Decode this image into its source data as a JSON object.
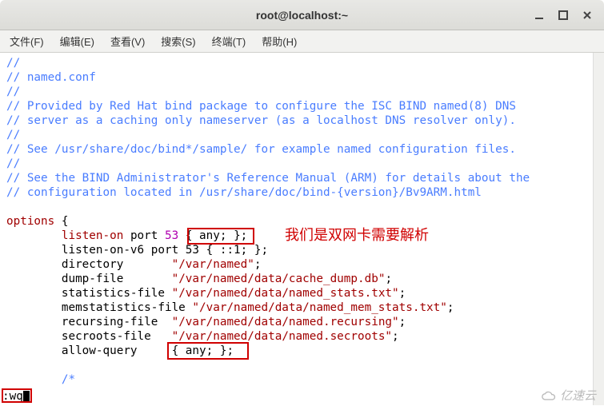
{
  "window": {
    "title": "root@localhost:~"
  },
  "menubar": {
    "file": "文件(F)",
    "edit": "编辑(E)",
    "view": "查看(V)",
    "search": "搜索(S)",
    "terminal": "终端(T)",
    "help": "帮助(H)"
  },
  "config": {
    "c1": "//",
    "c2": "// named.conf",
    "c3": "//",
    "c4": "// Provided by Red Hat bind package to configure the ISC BIND named(8) DNS",
    "c5": "// server as a caching only nameserver (as a localhost DNS resolver only).",
    "c6": "//",
    "c7": "// See /usr/share/doc/bind*/sample/ for example named configuration files.",
    "c8": "//",
    "c9": "// See the BIND Administrator's Reference Manual (ARM) for details about the",
    "c10": "// configuration located in /usr/share/doc/bind-{version}/Bv9ARM.html",
    "options_kw": "options",
    "brace": "{",
    "listen_on": "listen-on",
    "port_label": " port ",
    "port_num": "53",
    "listen_on_value": " { any; };",
    "listen_v6": "        listen-on-v6 port 53 { ::1; };",
    "dir_key": "        directory       ",
    "dir_val": "\"/var/named\"",
    "dump_key": "        dump-file       ",
    "dump_val": "\"/var/named/data/cache_dump.db\"",
    "stat_key": "        statistics-file ",
    "stat_val": "\"/var/named/data/named_stats.txt\"",
    "mem_key": "        memstatistics-file ",
    "mem_val": "\"/var/named/data/named_mem_stats.txt\"",
    "rec_key": "        recursing-file  ",
    "rec_val": "\"/var/named/data/named.recursing\"",
    "sec_key": "        secroots-file   ",
    "sec_val": "\"/var/named/data/named.secroots\"",
    "allow_key": "        allow-query     ",
    "allow_val": "{ any; };",
    "cstart": "        /*",
    "semi": ";"
  },
  "annotation": {
    "text": "我们是双网卡需要解析"
  },
  "command": {
    "prefix": ":",
    "text": "wq"
  },
  "watermark": {
    "text": "亿速云"
  }
}
